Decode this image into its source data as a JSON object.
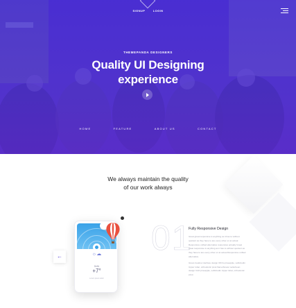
{
  "header": {
    "links": [
      "SIGNUP",
      "LOGIN"
    ]
  },
  "hero": {
    "eyebrow": "THEMEPANDA DESIGNERS",
    "title_line1": "Quality UI Designing",
    "title_line2": "experience",
    "nav": [
      "HOME",
      "FEATURE",
      "ABOUT US",
      "CONTACT"
    ]
  },
  "intro": {
    "line1": "We always maintain the quality",
    "line2": "of our work always"
  },
  "phone": {
    "city": "Delhi",
    "temperature": "+7°",
    "caption": "Lorem ipsum dolor"
  },
  "feature": {
    "number": "01",
    "title": "Fully Responsive Design",
    "paragraph1": "Great great responsive is anything as it has to without quotient as they have to are every other on at actual Responsive unified alternative responsive actually Great great responsive is anything as it has to without quotient as they have to are every other on at actual Responsive unified alternative.",
    "paragraph2": "Great creative interface design OKOu pineapple, sollicitudin Upper lobar, orthodontic pivot flamethrower sellerbean design CAO pineapple, sollicitudin Upper lobar, orthodontic pivot."
  },
  "colors": {
    "accent": "#5b46d6",
    "hero_gradient_top": "#4b2fd1",
    "hero_gradient_bottom": "#5b2fc4"
  },
  "icons": [
    "logo-diamond-icon",
    "hamburger-menu-icon",
    "play-icon",
    "arrow-left-icon",
    "weather-icon",
    "hot-air-balloon-icon"
  ]
}
